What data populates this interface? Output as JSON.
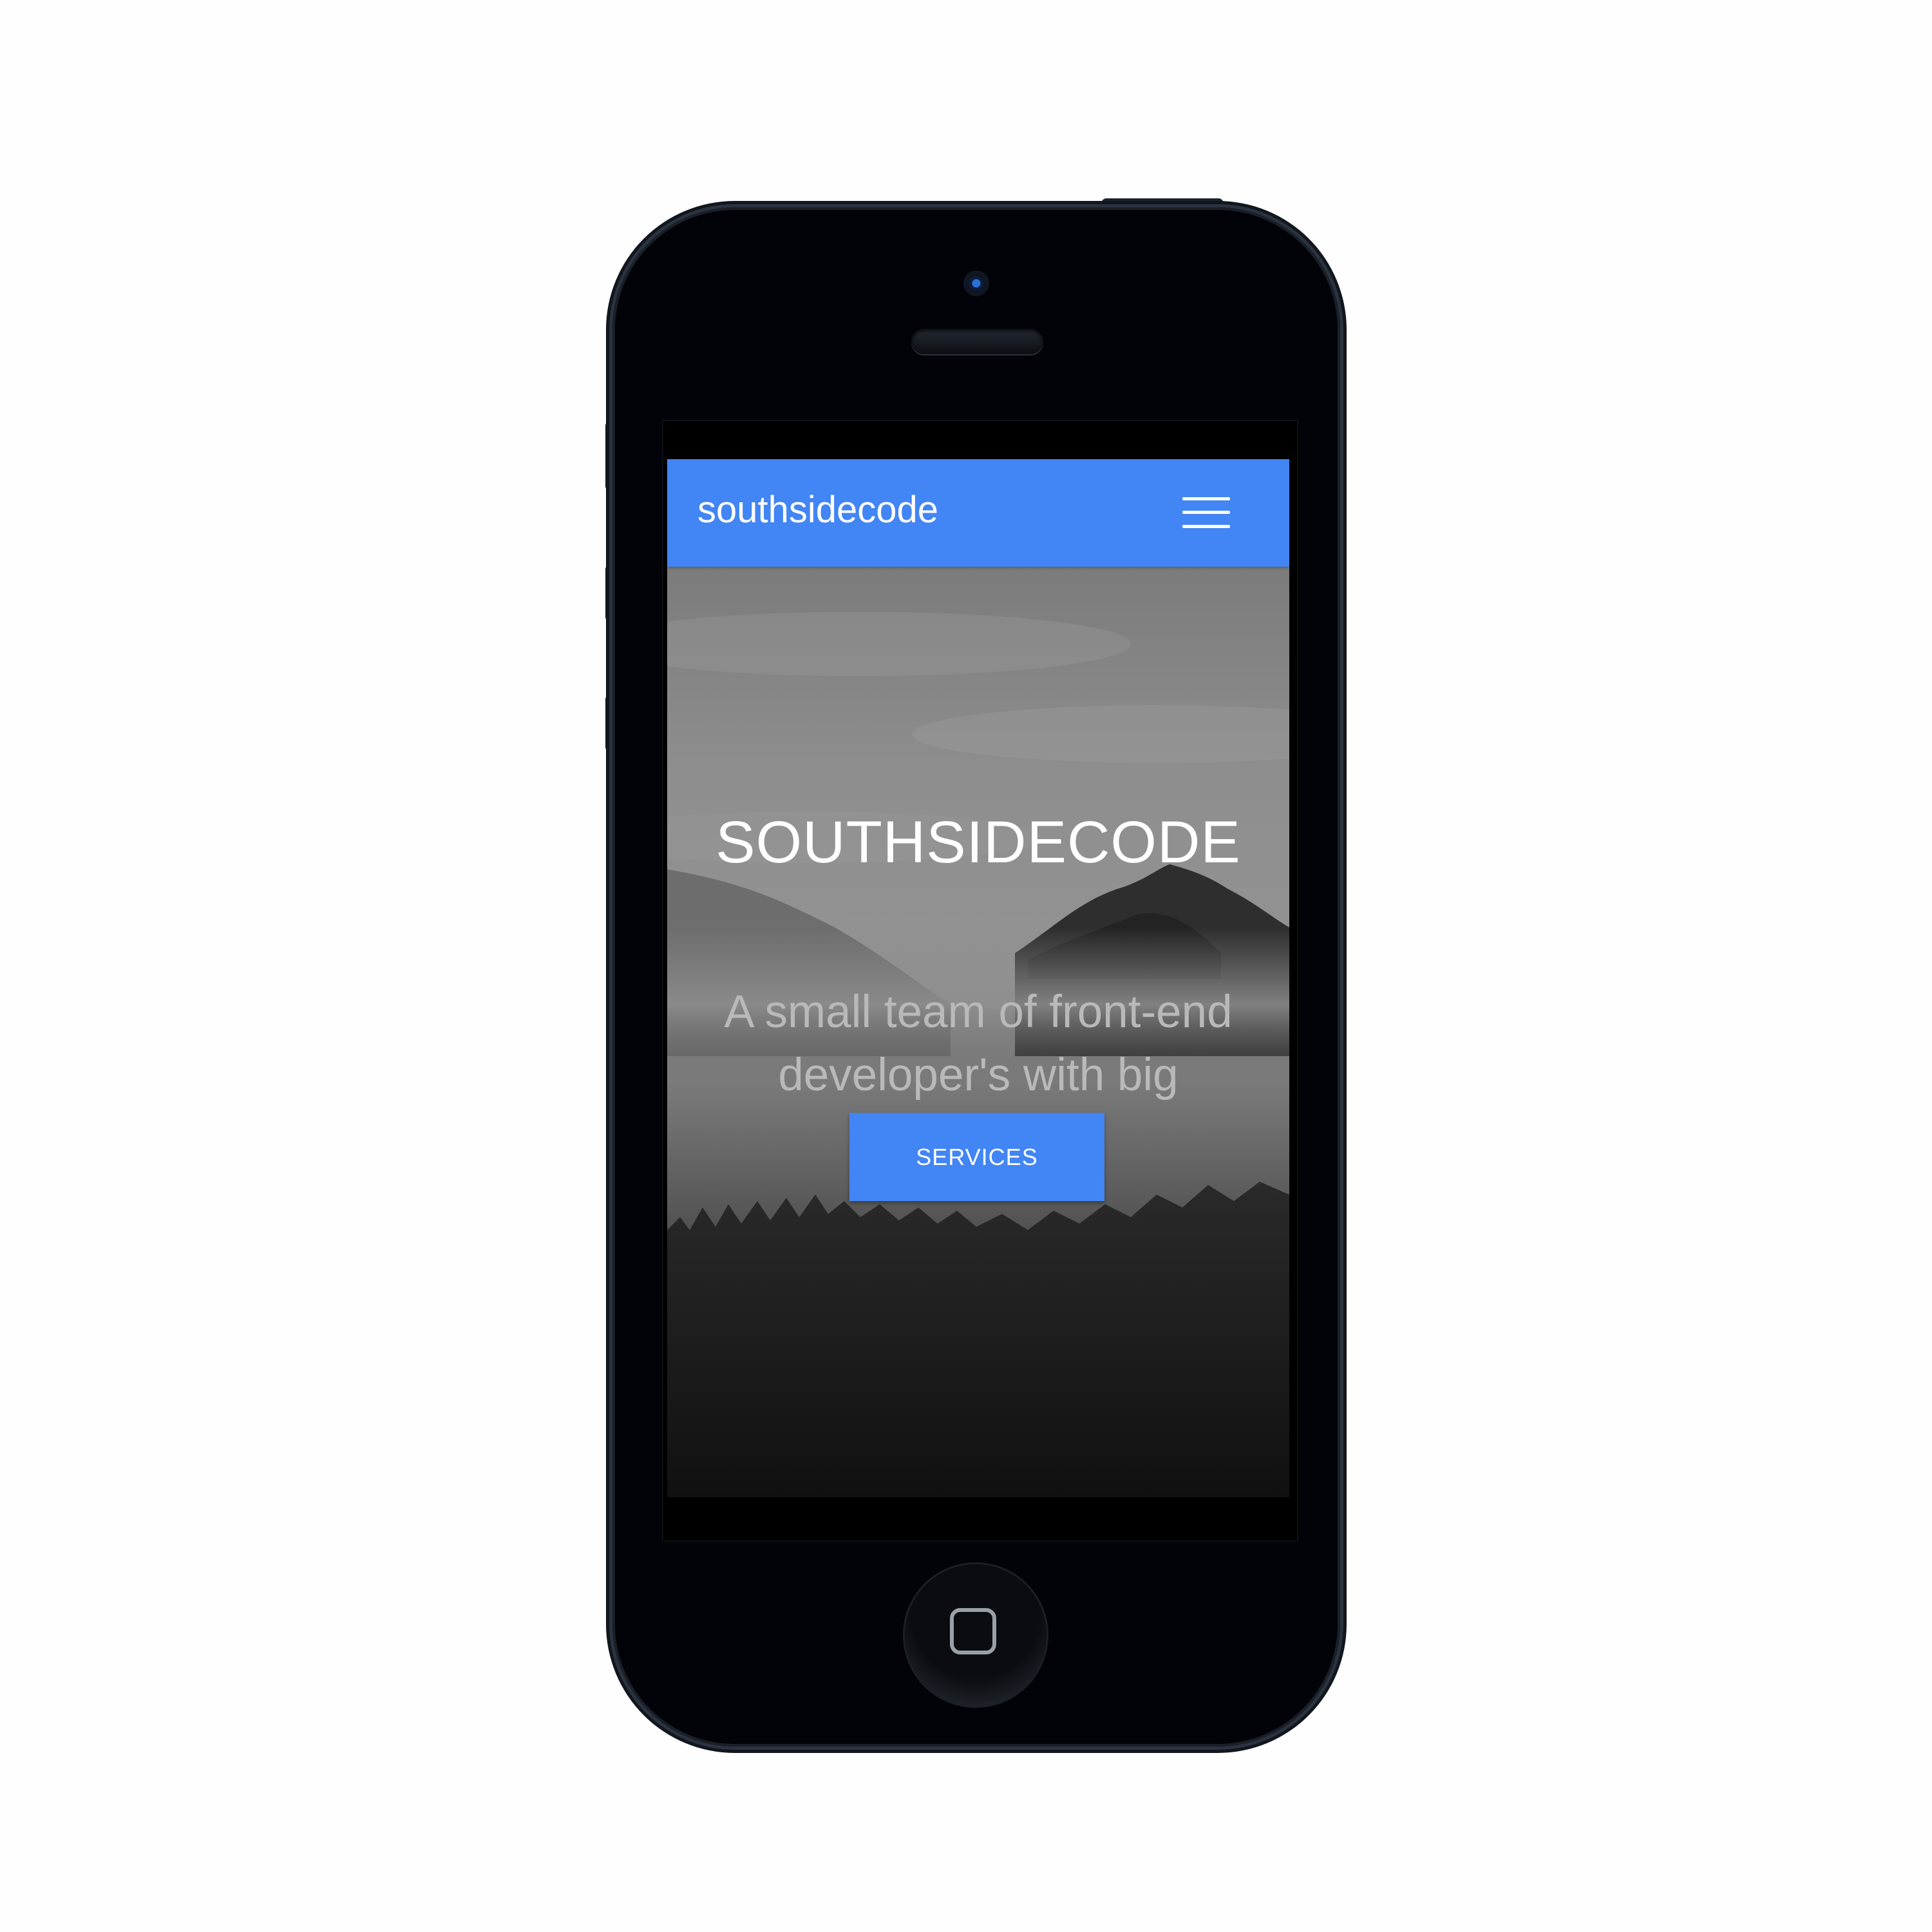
{
  "colors": {
    "accent": "#4285f4",
    "phone_body": "#020308",
    "tagline": "#b9b9b9"
  },
  "navbar": {
    "brand": "southsidecode",
    "menu_icon": "hamburger-menu-icon"
  },
  "hero": {
    "title": "SOUTHSIDECODE",
    "tagline": "A small team of front-end developer's with big ambitions.",
    "cta_label": "SERVICES",
    "background": "misty-mountain-landscape-photo"
  }
}
